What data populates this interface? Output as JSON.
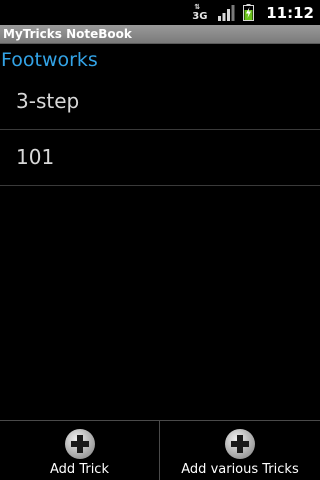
{
  "status_bar": {
    "network_type": "3G",
    "network_arrows": "⇅",
    "signal_icon": "signal-icon",
    "battery_icon": "battery-charging-icon",
    "time": "11:12"
  },
  "title_bar": {
    "title": "MyTricks NoteBook"
  },
  "section": {
    "title": "Footworks",
    "color": "#33a3e6"
  },
  "tricks": [
    {
      "label": "3-step"
    },
    {
      "label": "101"
    }
  ],
  "bottom_bar": {
    "buttons": [
      {
        "label": "Add Trick",
        "icon": "plus-circle-icon"
      },
      {
        "label": "Add various Tricks",
        "icon": "plus-circle-icon"
      }
    ]
  }
}
